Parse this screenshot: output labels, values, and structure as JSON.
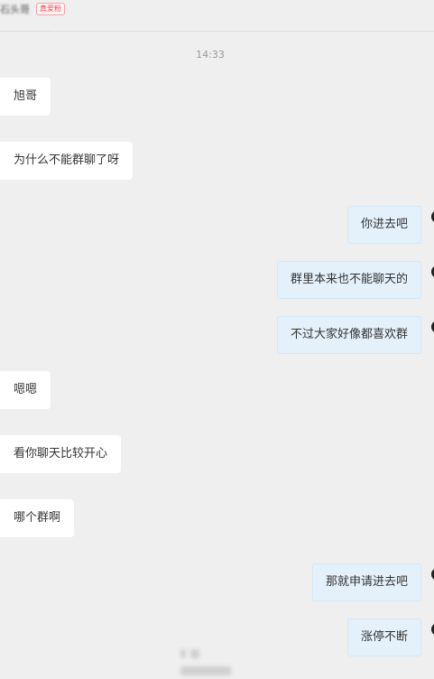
{
  "header": {
    "contact_name": "石头哥",
    "fan_badge": "真爱粉"
  },
  "timestamp": "14:33",
  "messages": [
    {
      "side": "in",
      "text": "旭哥"
    },
    {
      "side": "in",
      "text": "为什么不能群聊了呀"
    },
    {
      "side": "out",
      "text": "你进去吧"
    },
    {
      "side": "out",
      "text": "群里本来也不能聊天的"
    },
    {
      "side": "out",
      "text": "不过大家好像都喜欢群"
    },
    {
      "side": "in",
      "text": "嗯嗯"
    },
    {
      "side": "in",
      "text": "看你聊天比较开心"
    },
    {
      "side": "in",
      "text": "哪个群啊"
    },
    {
      "side": "out",
      "text": "那就申请进去吧"
    },
    {
      "side": "out",
      "text": "涨停不断"
    }
  ]
}
